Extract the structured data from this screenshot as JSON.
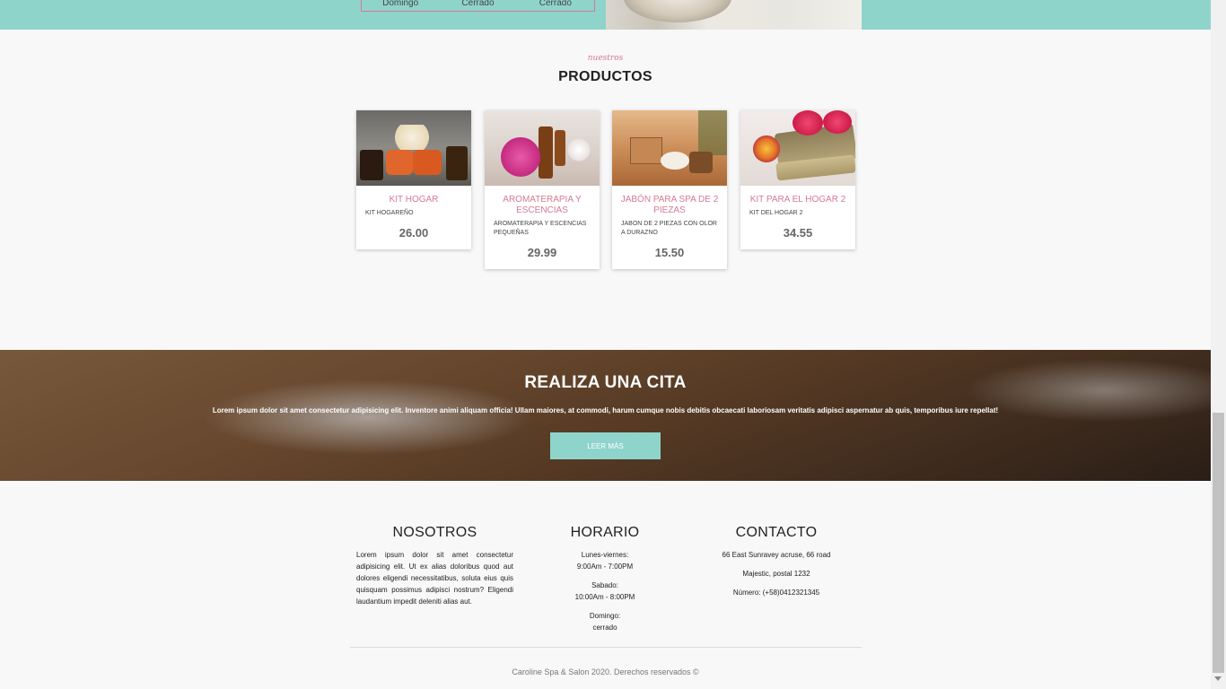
{
  "hours_strip": {
    "day": "Domingo",
    "morning": "Cerrado",
    "evening": "Cerrado"
  },
  "products": {
    "eyebrow": "nuestros",
    "title": "PRODUCTOS",
    "items": [
      {
        "name": "KIT HOGAR",
        "desc": "KIT HOGAREÑO",
        "price": "26.00"
      },
      {
        "name": "AROMATERAPIA Y ESCENCIAS",
        "desc": "AROMATERAPIA Y ESCENCIAS PEQUEÑAS",
        "price": "29.99"
      },
      {
        "name": "JABÓN PARA SPA DE 2 PIEZAS",
        "desc": "JABON DE 2 PIEZAS CON OLOR A DURAZNO",
        "price": "15.50"
      },
      {
        "name": "KIT PARA EL HOGAR 2",
        "desc": "KIT DEL HOGAR 2",
        "price": "34.55"
      }
    ]
  },
  "appointment": {
    "title": "REALIZA UNA CITA",
    "text": "Lorem ipsum dolor sit amet consectetur adipisicing elit. Inventore animi aliquam officia! Ullam maiores, at commodi, harum cumque nobis debitis obcaecati laboriosam veritatis adipisci aspernatur ab quis, temporibus iure repellat!",
    "button": "LEER MÁS"
  },
  "footer": {
    "about": {
      "title": "NOSOTROS",
      "text": "Lorem ipsum dolor sit amet consectetur adipisicing elit. Ut ex alias doloribus quod aut dolores eligendi necessitatibus, soluta eius quis quisquam possimus adipisci nostrum? Eligendi laudantium impedit deleniti alias aut."
    },
    "hours": {
      "title": "HORARIO",
      "weekdays_label": "Lunes-viernes:",
      "weekdays_time": "9:00Am - 7:00PM",
      "saturday_label": "Sabado:",
      "saturday_time": "10:00Am - 8:00PM",
      "sunday_label": "Domingo:",
      "sunday_time": "cerrado"
    },
    "contact": {
      "title": "CONTACTO",
      "address": "66 East Sunravey acruse, 66 road",
      "city": "Majestic, postal 1232",
      "phone": "Número: (+58)0412321345"
    },
    "copyright": "Caroline Spa & Salon 2020. Derechos reservados ©"
  },
  "colors": {
    "accent": "#8fd4cb",
    "pink": "#d47a93"
  }
}
